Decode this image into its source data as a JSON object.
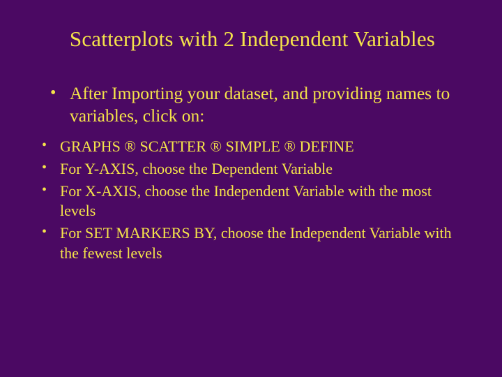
{
  "title": "Scatterplots with 2 Independent Variables",
  "primary": [
    "After Importing your dataset, and providing names to variables, click on:"
  ],
  "secondary": [
    "GRAPHS ® SCATTER ® SIMPLE ® DEFINE",
    "For Y-AXIS, choose the Dependent Variable",
    "For X-AXIS, choose the Independent Variable with the most levels",
    "For SET MARKERS BY, choose the Independent Variable with the fewest levels"
  ]
}
